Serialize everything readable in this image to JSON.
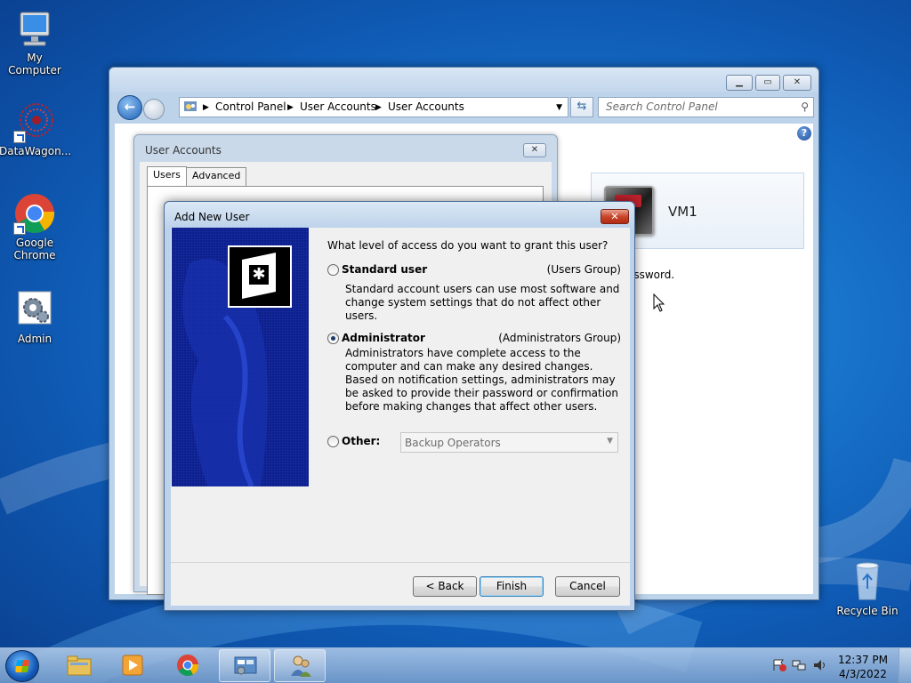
{
  "desktop": {
    "icons": [
      {
        "label": "My Computer"
      },
      {
        "label": "DataWagon..."
      },
      {
        "label": "Google Chrome"
      },
      {
        "label": "Admin"
      },
      {
        "label": "Recycle Bin"
      }
    ]
  },
  "control_panel": {
    "breadcrumb": [
      "Control Panel",
      "User Accounts",
      "User Accounts"
    ],
    "search_placeholder": "Search Control Panel",
    "user_name": "VM1",
    "partial_text": "assword."
  },
  "user_accounts_dialog": {
    "title": "User Accounts",
    "tabs": [
      "Users",
      "Advanced"
    ],
    "active_tab": "Users"
  },
  "add_new_user_dialog": {
    "title": "Add New User",
    "question": "What level of access do you want to grant this user?",
    "options": [
      {
        "label": "Standard user",
        "group": "(Users Group)",
        "description": "Standard account users can use most software and change system settings that do not affect other users.",
        "selected": false
      },
      {
        "label": "Administrator",
        "group": "(Administrators Group)",
        "description": "Administrators have complete access to the computer and can make any desired changes. Based on notification settings, administrators may be asked to provide their password or confirmation before making changes that affect other users.",
        "selected": true
      },
      {
        "label": "Other:",
        "selected": false
      }
    ],
    "other_select_value": "Backup Operators",
    "buttons": {
      "back": "< Back",
      "finish": "Finish",
      "cancel": "Cancel"
    }
  },
  "taskbar": {
    "time": "12:37 PM",
    "date": "4/3/2022"
  },
  "colors": {
    "desktop_blue": "#1a78cf",
    "close_red": "#c9452b",
    "wizard_sidebar": "#0e1f8a"
  }
}
